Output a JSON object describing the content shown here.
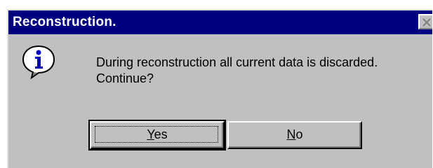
{
  "dialog": {
    "title": "Reconstruction.",
    "message_line1": "During reconstruction all current data is discarded.",
    "message_line2": "Continue?",
    "icon": "info-icon",
    "close_icon": "close-icon"
  },
  "buttons": {
    "yes": {
      "mnemonic": "Y",
      "rest": "es"
    },
    "no": {
      "mnemonic": "N",
      "rest": "o"
    }
  },
  "colors": {
    "titlebar": "#000080",
    "face": "#c0c0c0",
    "title_text": "#ffffff"
  }
}
